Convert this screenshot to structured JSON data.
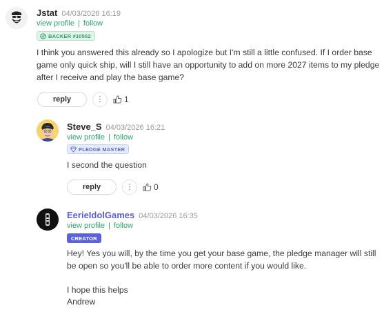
{
  "comments": [
    {
      "author": "Jstat",
      "timestamp": "04/03/2026 16:19",
      "view_profile": "view profile",
      "separator": "|",
      "follow": "follow",
      "badge": "BACKER #10552",
      "body": "I think you answered this already so I apologize but I'm still a little confused. If I order base game only quick ship, will I still have an opportunity to add on more 2027 items to my pledge after I receive and play the base game?",
      "reply_label": "reply",
      "more_label": "⋮",
      "likes": "1"
    },
    {
      "author": "Steve_S",
      "timestamp": "04/03/2026 16:21",
      "view_profile": "view profile",
      "separator": "|",
      "follow": "follow",
      "badge": "PLEDGE MASTER",
      "body": "I second the question",
      "reply_label": "reply",
      "more_label": "⋮",
      "likes": "0"
    },
    {
      "author": "EerieIdolGames",
      "timestamp": "04/03/2026 16:35",
      "view_profile": "view profile",
      "separator": "|",
      "follow": "follow",
      "badge": "CREATOR",
      "body_p1": "Hey! Yes you will, by the time you get your base game, the pledge manager will still be open so you'll be able to order more content if you would like.",
      "body_p2": "I hope this helps",
      "body_p3": "Andrew"
    }
  ],
  "colors": {
    "link_green": "#2ea36a",
    "creator_purple": "#5c63d6",
    "backer_badge_bg": "#e1f5ea",
    "master_badge_bg": "#e6ecfb"
  }
}
